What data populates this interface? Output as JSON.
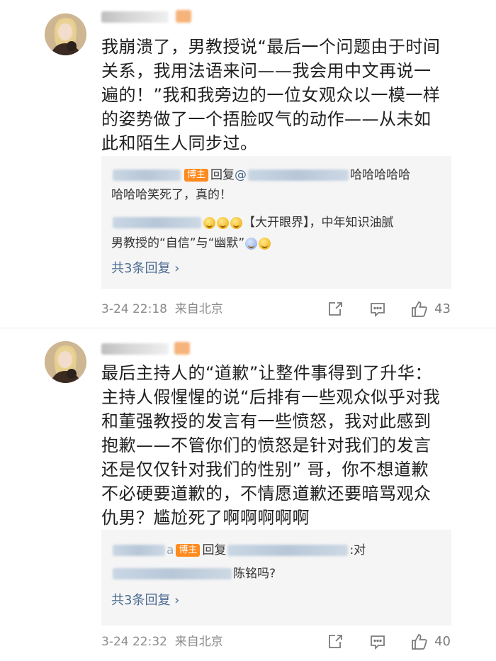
{
  "comments": [
    {
      "text": "我崩溃了，男教授说“最后一个问题由于时间关系，我用法语来问——我会用中文再说一遍的！”我和我旁边的一位女观众以一模一样的姿势做了一个捂脸叹气的动作——从未如此和陌生人同步过。",
      "replies": [
        {
          "author_tag": "博主",
          "prefix": "回复",
          "at": "@",
          "text_a": "哈哈哈哈哈",
          "text_b": "哈哈哈笑死了，真的！"
        },
        {
          "text_a": "【大开眼界】，中年知识油腻",
          "text_b": "男教授的“自信”与“幽默”",
          "emoji_icons": [
            "smirk-emoji",
            "smirk-emoji",
            "smirk-emoji",
            "sweat-emoji",
            "smile-emoji"
          ]
        }
      ],
      "more_replies": "共3条回复 ›",
      "time": "3-24 22:18",
      "source": "来自北京",
      "likes": "43"
    },
    {
      "text": "最后主持人的“道歉”让整件事得到了升华：主持人假惺惺的说“后排有一些观众似乎对我和董强教授的发言有一些愤怒，我对此感到抱歉——不管你们的愤怒是针对我们的发言还是仅仅针对我们的性别” 哥，你不想道歉不必硬要道歉的，不情愿道歉还要暗骂观众仇男？尴尬死了啊啊啊啊啊",
      "replies": [
        {
          "name_tail": "a",
          "author_tag": "博主",
          "prefix": "回复",
          "text_a": ":对",
          "text_b": "陈铭吗?"
        }
      ],
      "more_replies": "共3条回复 ›",
      "time": "3-24 22:32",
      "source": "来自北京",
      "likes": "40"
    }
  ],
  "colors": {
    "link": "#4a6a91",
    "author_tag": "#ff8a1e",
    "meta": "#8c8c8c"
  },
  "icons": [
    "repost-icon",
    "comment-icon",
    "like-icon"
  ]
}
